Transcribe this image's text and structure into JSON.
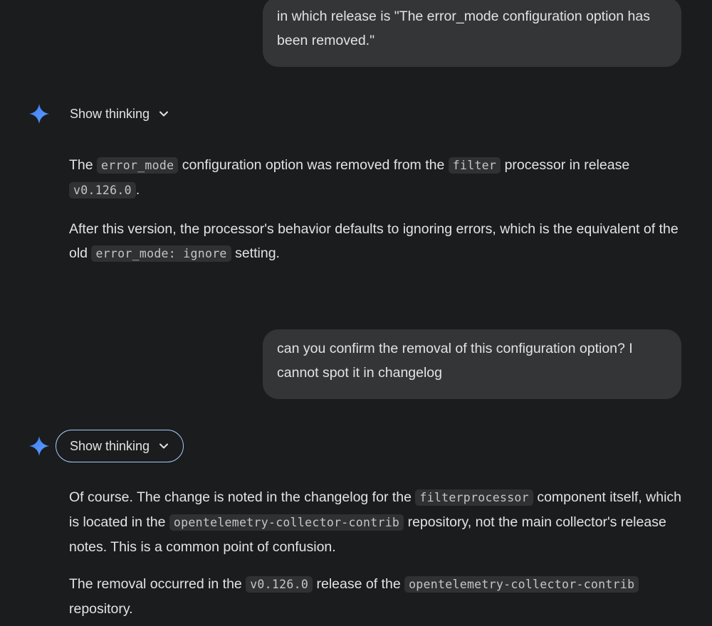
{
  "conversation": {
    "user_message_1": "in which release is \"The error_mode configuration option has been removed.\"",
    "assistant_1": {
      "thinking_label": "Show thinking",
      "p1_a": "The ",
      "p1_code_1": "error_mode",
      "p1_b": " configuration option was removed from the ",
      "p1_code_2": "filter",
      "p1_c": " processor in release ",
      "p1_code_3": "v0.126.0",
      "p1_d": ".",
      "p2_a": "After this version, the processor's behavior defaults to ignoring errors, which is the equivalent of the old ",
      "p2_code_1": "error_mode: ignore",
      "p2_b": " setting."
    },
    "user_message_2": "can you confirm the removal of this configuration option? I cannot spot it in changelog",
    "assistant_2": {
      "thinking_label": "Show thinking",
      "p1_a": "Of course. The change is noted in the changelog for the ",
      "p1_code_1": "filterprocessor",
      "p1_b": " component itself, which is located in the ",
      "p1_code_2": "opentelemetry-collector-contrib",
      "p1_c": " repository, not the main collector's release notes. This is a common point of confusion.",
      "p2_a": "The removal occurred in the ",
      "p2_code_1": "v0.126.0",
      "p2_b": " release of the ",
      "p2_code_2": "opentelemetry-collector-contrib",
      "p2_c": " repository."
    }
  },
  "icons": {
    "assistant": "gemini-spark-icon",
    "toggle": "chevron-down-icon"
  },
  "colors": {
    "background": "#1b1c1d",
    "user_bubble": "#333537",
    "code_bg": "#2f3133",
    "accent_outline": "#a8c7fa",
    "spark_blue": "#4a8df8"
  }
}
